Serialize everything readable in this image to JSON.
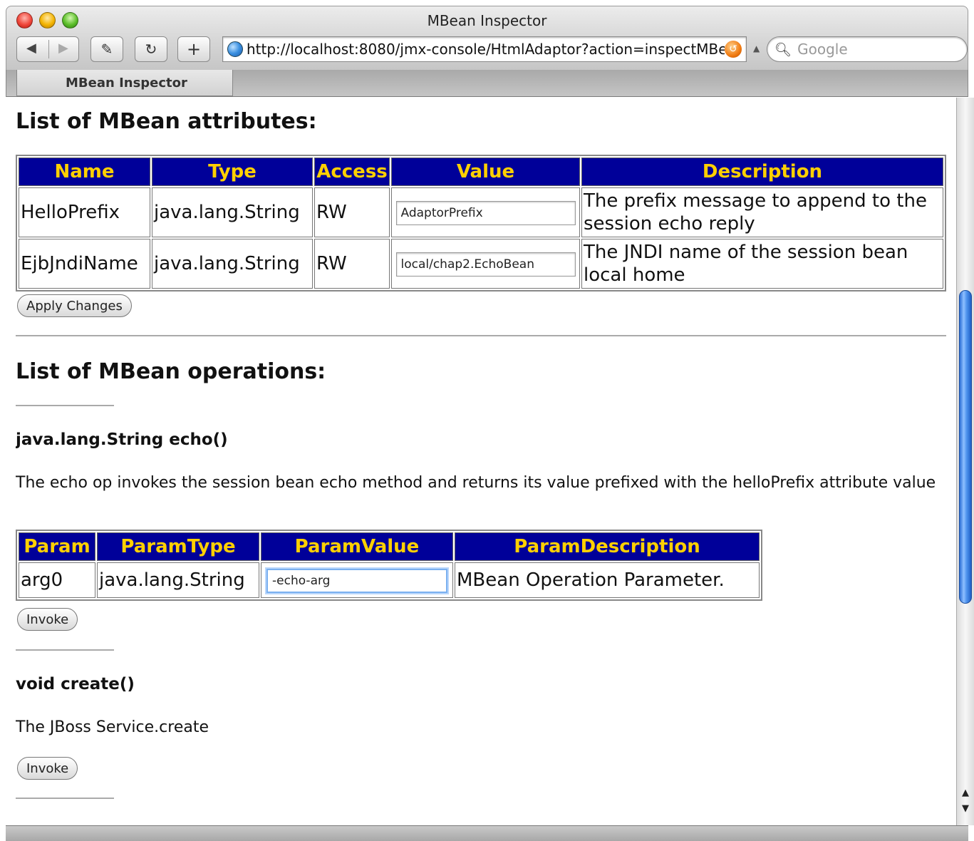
{
  "window": {
    "title": "MBean Inspector",
    "url": "http://localhost:8080/jmx-console/HtmlAdaptor?action=inspectMBean&name=chap2:service=EchoService",
    "search_placeholder": "Google",
    "tab_title": "MBean Inspector"
  },
  "attributes": {
    "heading": "List of MBean attributes:",
    "columns": [
      "Name",
      "Type",
      "Access",
      "Value",
      "Description"
    ],
    "rows": [
      {
        "name": "HelloPrefix",
        "type": "java.lang.String",
        "access": "RW",
        "value": "AdaptorPrefix",
        "description": "The prefix message to append to the session echo reply"
      },
      {
        "name": "EjbJndiName",
        "type": "java.lang.String",
        "access": "RW",
        "value": "local/chap2.EchoBean",
        "description": "The JNDI name of the session bean local home"
      }
    ],
    "apply_label": "Apply Changes"
  },
  "operations": {
    "heading": "List of MBean operations:",
    "echo": {
      "signature": "java.lang.String echo()",
      "description": "The echo op invokes the session bean echo method and returns its value prefixed with the helloPrefix attribute value",
      "columns": [
        "Param",
        "ParamType",
        "ParamValue",
        "ParamDescription"
      ],
      "params": [
        {
          "param": "arg0",
          "type": "java.lang.String",
          "value": "-echo-arg",
          "description": "MBean Operation Parameter."
        }
      ],
      "invoke_label": "Invoke"
    },
    "create": {
      "signature": "void create()",
      "description": "The JBoss Service.create",
      "invoke_label": "Invoke"
    }
  }
}
